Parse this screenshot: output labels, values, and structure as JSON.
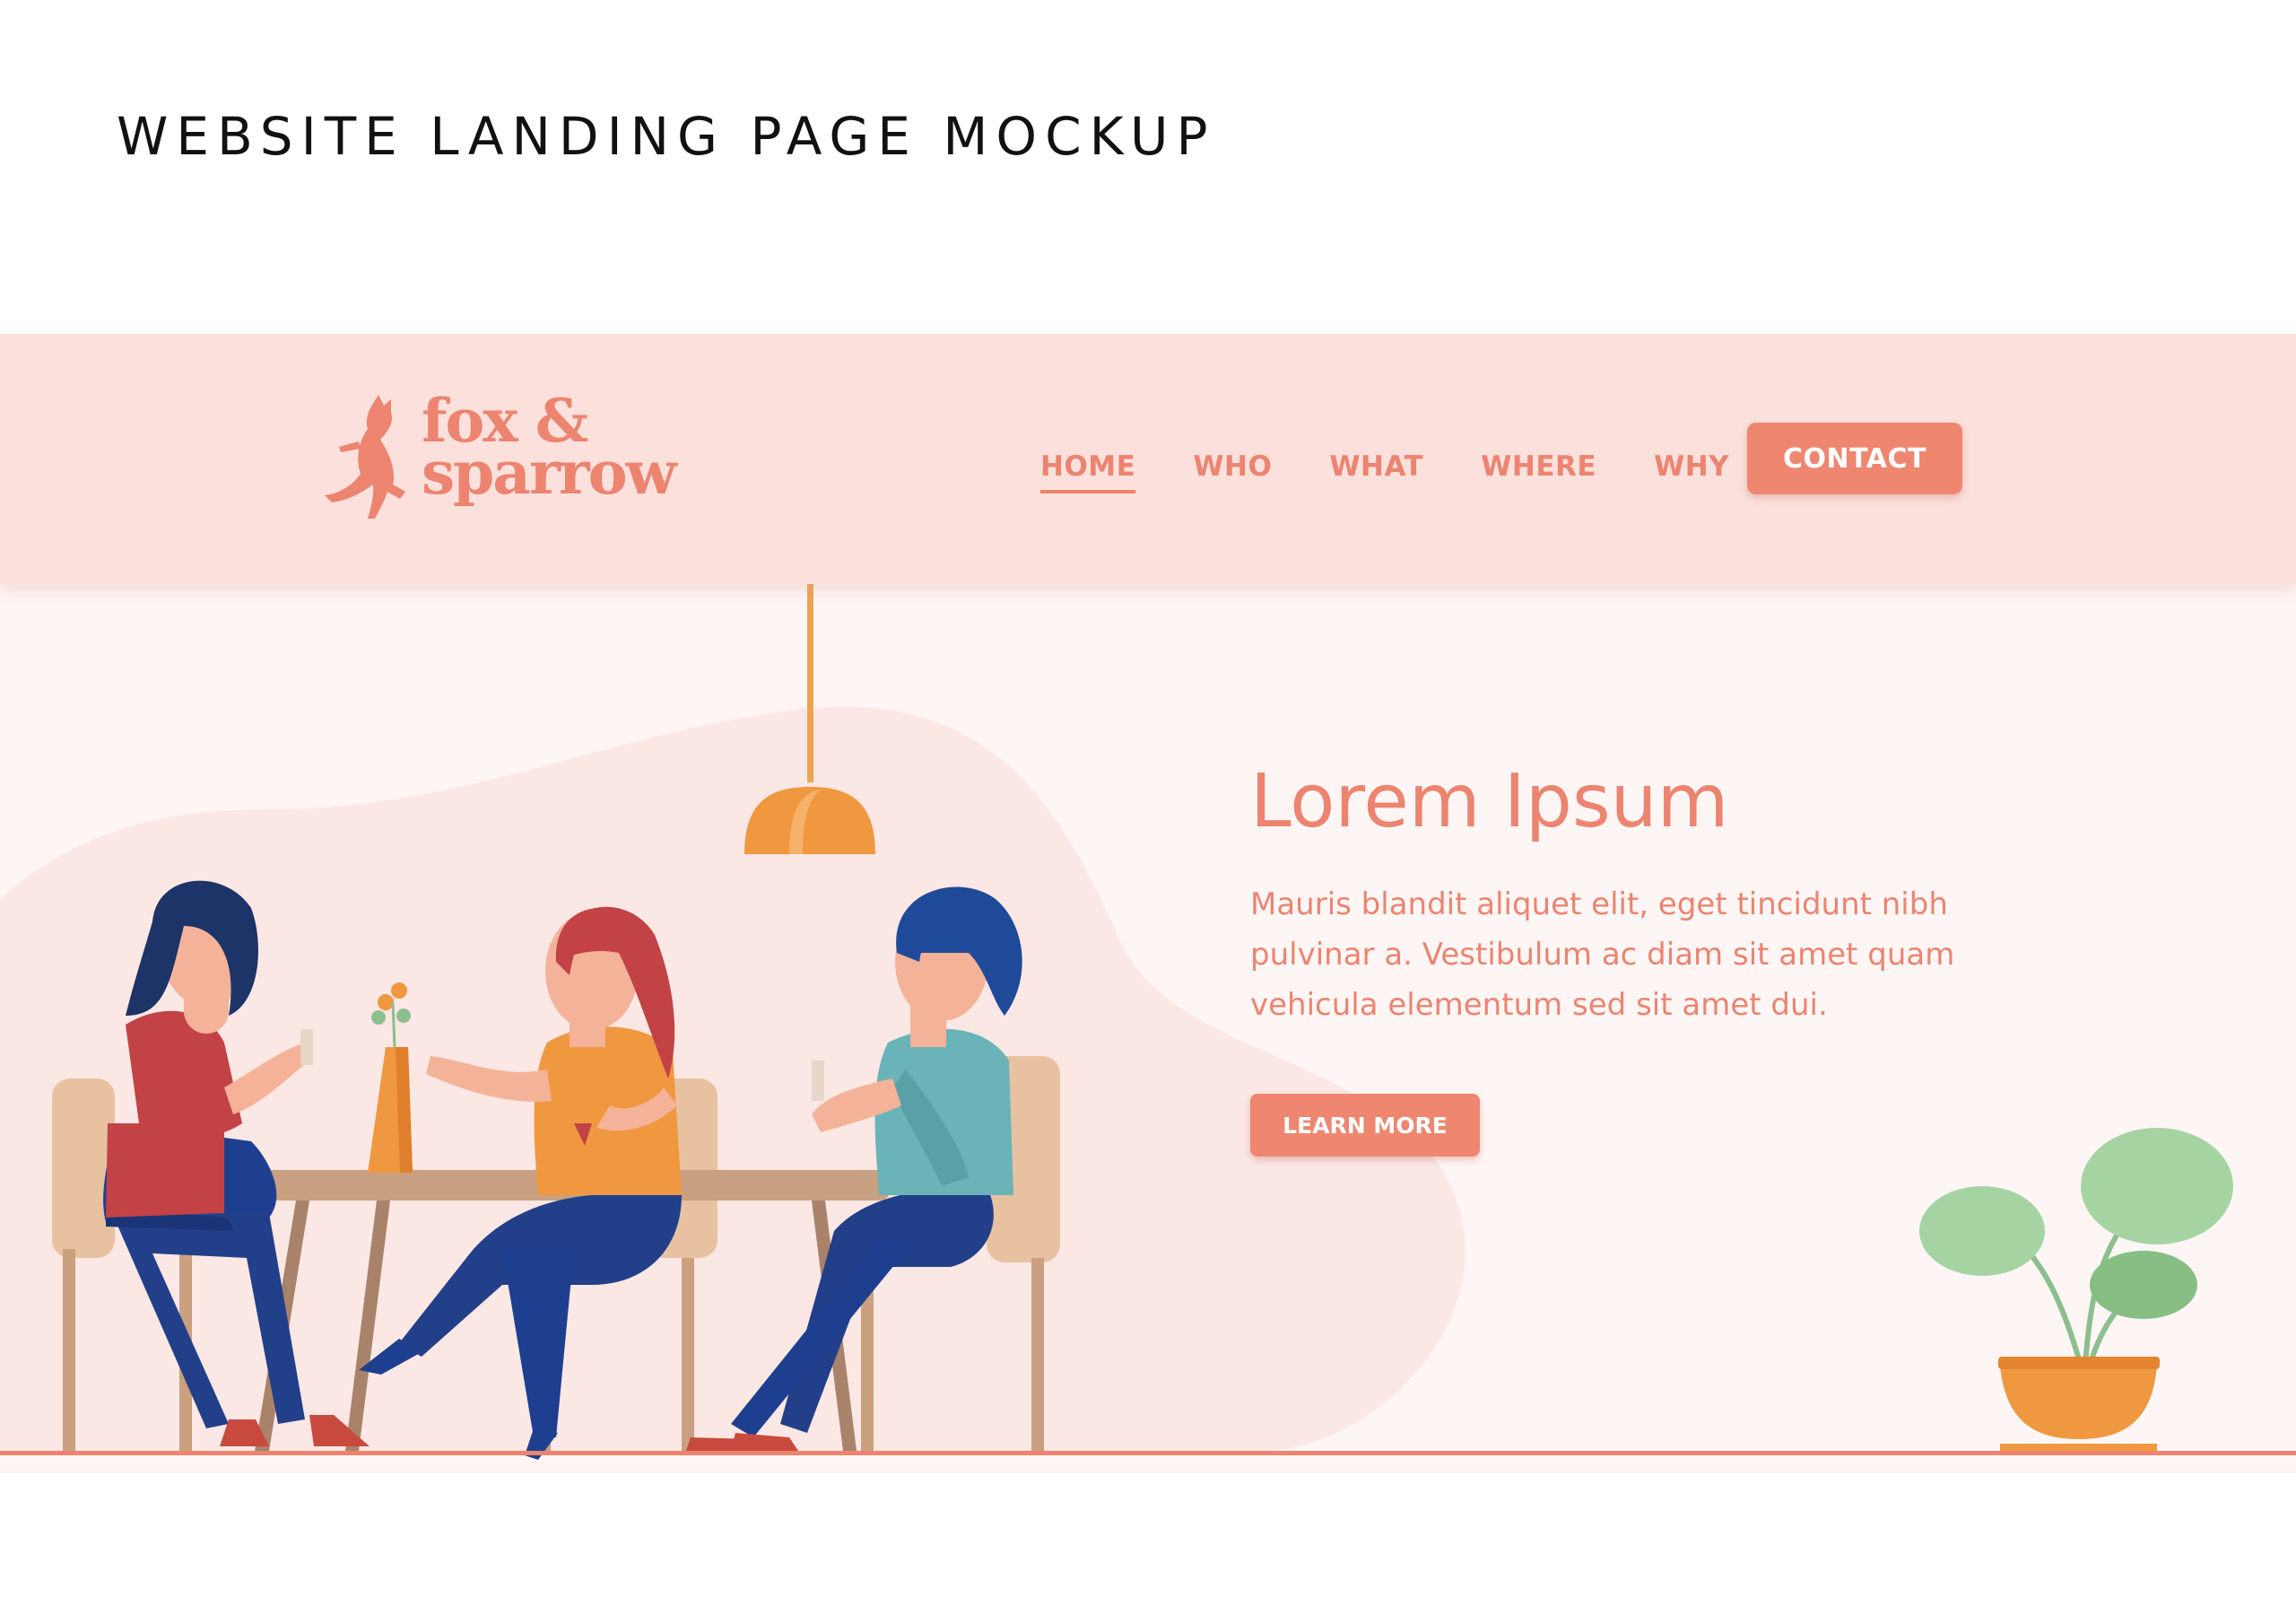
{
  "page": {
    "caption": "WEBSITE LANDING PAGE MOCKUP"
  },
  "site": {
    "logo": {
      "line1": "fox &",
      "line2": "sparrow"
    },
    "nav": {
      "items": [
        {
          "label": "HOME",
          "active": true
        },
        {
          "label": "WHO",
          "active": false
        },
        {
          "label": "WHAT",
          "active": false
        },
        {
          "label": "WHERE",
          "active": false
        },
        {
          "label": "WHY",
          "active": false
        }
      ],
      "contact_label": "CONTACT"
    },
    "hero": {
      "title": "Lorem Ipsum",
      "body_line1": "Mauris blandit aliquet elit, eget tincidunt nibh",
      "body_line2": "pulvinar a. Vestibulum ac diam sit amet quam",
      "body_line3": "vehicula elementum sed sit amet dui.",
      "cta_label": "LEARN MORE"
    }
  },
  "colors": {
    "accent": "#ec8470",
    "header_bg": "#fbe0dc",
    "page_bg": "#fdf6f5",
    "blob": "#fbe7e4"
  },
  "icons": {
    "logo": "fox-icon"
  }
}
